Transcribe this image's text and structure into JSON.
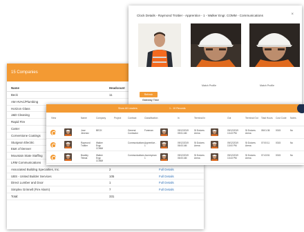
{
  "companies": {
    "title": "15 Companies",
    "header": {
      "name": "Name",
      "headcount": "Headcount"
    },
    "rows": [
      {
        "name": "Beck",
        "count": "11",
        "details": ""
      },
      {
        "name": "AM HVAC/Plumbing",
        "count": "",
        "details": ""
      },
      {
        "name": "Horizon Glass",
        "count": "",
        "details": ""
      },
      {
        "name": "J&D Cleaning",
        "count": "",
        "details": ""
      },
      {
        "name": "Rapid Fire",
        "count": "",
        "details": ""
      },
      {
        "name": "Carter",
        "count": "",
        "details": ""
      },
      {
        "name": "Cornerstone Coatings",
        "count": "",
        "details": ""
      },
      {
        "name": "Sturgeon Electric",
        "count": "",
        "details": ""
      },
      {
        "name": "E&K of Denver",
        "count": "",
        "details": ""
      },
      {
        "name": "Mountain State Staffing",
        "count": "20",
        "details": "Full Details"
      },
      {
        "name": "LRM Communications",
        "count": "10",
        "details": "Full Details"
      },
      {
        "name": "Associated Building Specialties, Inc.",
        "count": "2",
        "details": "Full Details"
      },
      {
        "name": "UBS - United Builder Services",
        "count": "105",
        "details": "Full Details"
      },
      {
        "name": "Direct Lumber and Door",
        "count": "1",
        "details": "Full Details"
      },
      {
        "name": "Simplex Grinnell (Fire Alarm)",
        "count": "7",
        "details": "Full Details"
      },
      {
        "name": "Total:",
        "count": "331",
        "details": ""
      }
    ]
  },
  "clock": {
    "title": "Clock Details - Raymond Trottier - Apprentice - 1 - Walker Engr. COMM - Communications",
    "close": "×",
    "caption1": "Match Profile",
    "caption2": "Match Profile",
    "refresh": "Refresh",
    "gateway": "Gateway   Time"
  },
  "times": {
    "bar_left": "",
    "bar_mid": "Show All Leaders",
    "bar_right": "1 - 10 Records",
    "headers": [
      "View",
      "",
      "Name",
      "Company",
      "Project",
      "Contract",
      "Classification",
      "In",
      "Terminal In",
      "",
      "Out",
      "Terminal Out",
      "Total Hours",
      "Cost Code",
      "Notes"
    ],
    "rows": [
      {
        "name": "Jose\nJimenez",
        "company": "BECK",
        "project": "",
        "contract": "General\nContractor",
        "class": "Foreman",
        "in": "09/12/2019\n05:51 AM",
        "term_in": "St Dolores\nArena",
        "out": "09/12/2019\n13:43 PM",
        "term_out": "St Dolores\nArena",
        "hours": "08:01:36",
        "cost": "0015",
        "notes": "No"
      },
      {
        "name": "Raymond\nTrottier",
        "company": "Walker\nEngr.\nCOMM",
        "project": "",
        "contract": "Communications",
        "class": "Apprentice -\n1",
        "in": "09/12/2019\n06:00 AM",
        "term_in": "St Dolores\nArena",
        "out": "09/12/2019\n13:00 PM",
        "term_out": "St Dolores\nArena",
        "hours": "07:00:11",
        "cost": "0015",
        "notes": "No"
      },
      {
        "name": "Bradley\nTeteak",
        "company": "Walker\nEngr.\nCOMM",
        "project": "",
        "contract": "Communications",
        "class": "Journeyman\n1",
        "in": "09/12/2019\n06:00 AM",
        "term_in": "St Dolores\nArena",
        "out": "09/12/2019\n13:43 PM",
        "term_out": "St Dolores\nArena",
        "hours": "07:43:51",
        "cost": "0015",
        "notes": "No"
      }
    ]
  },
  "colors": {
    "accent": "#f39a33",
    "link": "#2f6fb5",
    "navy": "#1d2f4e"
  }
}
